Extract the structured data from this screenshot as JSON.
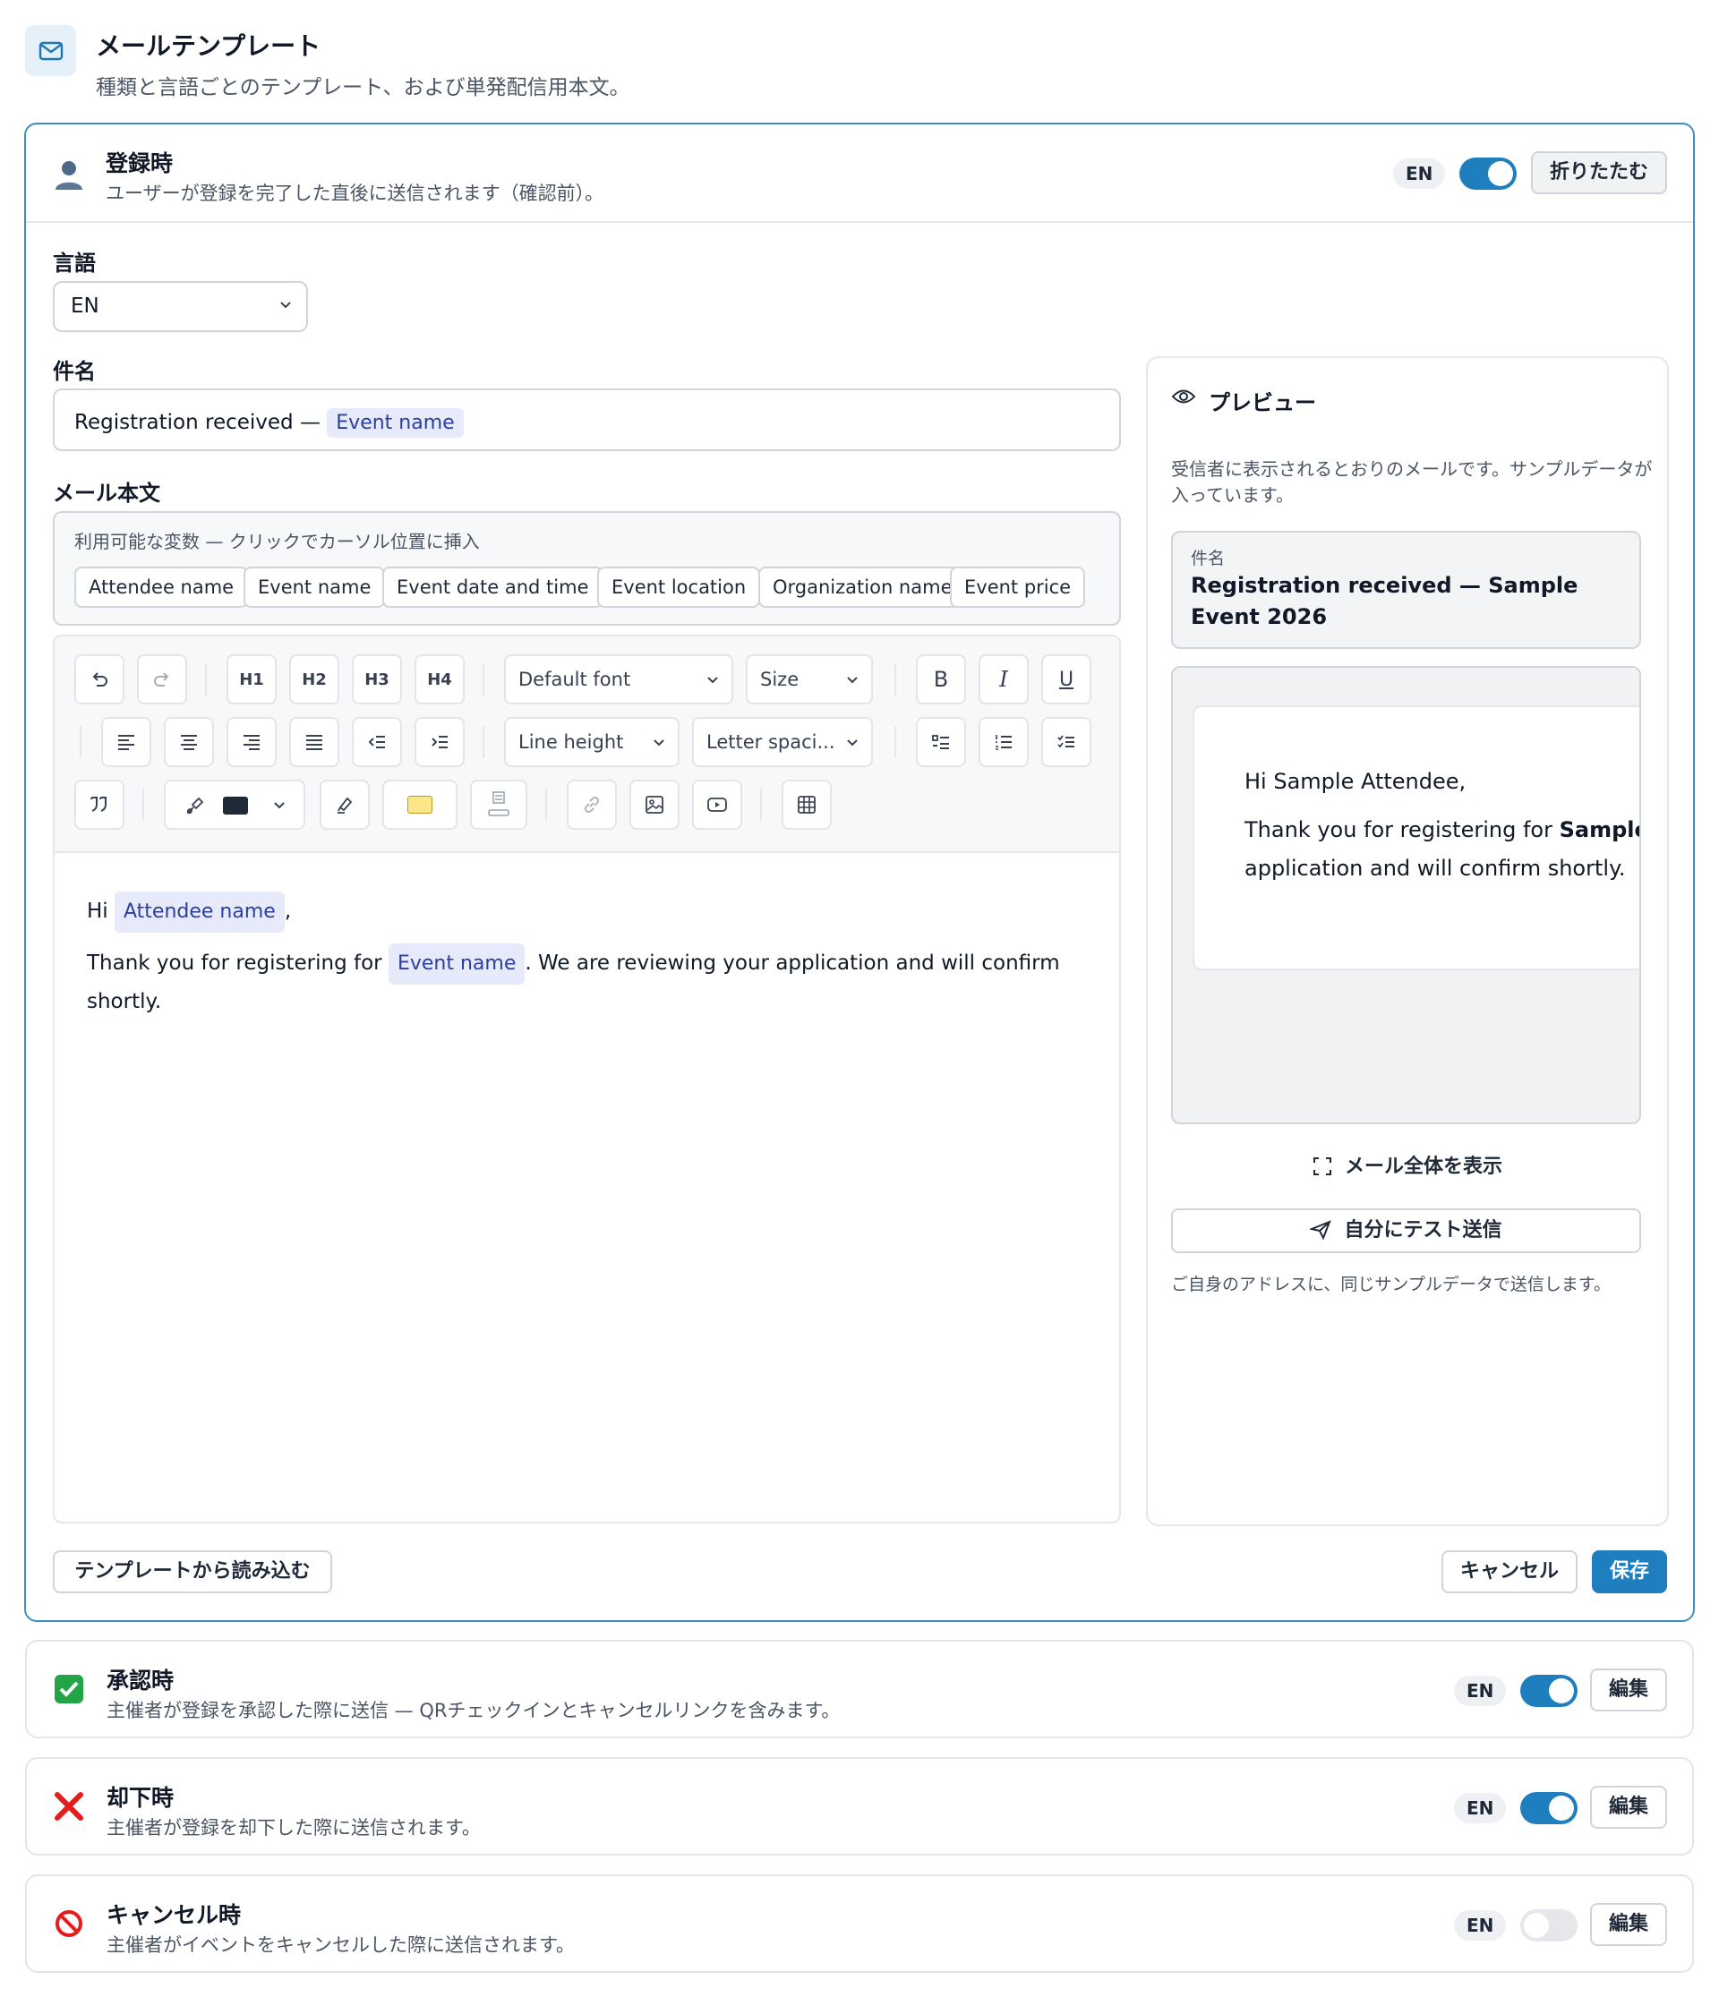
{
  "header": {
    "title": "メールテンプレート",
    "subtitle": "種類と言語ごとのテンプレート、および単発配信用本文。"
  },
  "registration": {
    "title": "登録時",
    "description": "ユーザーが登録を完了した直後に送信されます（確認前）。",
    "lang_badge": "EN",
    "enabled": true,
    "collapse_label": "折りたたむ",
    "language_label": "言語",
    "language_value": "EN",
    "subject_label": "件名",
    "subject_text": "Registration received —",
    "subject_token": "Event name",
    "body_label": "メール本文",
    "variables_hint": "利用可能な変数 — クリックでカーソル位置に挿入",
    "variables": [
      "Attendee name",
      "Event name",
      "Event date and time",
      "Event location",
      "Organization name",
      "Event price"
    ],
    "toolbar": {
      "headings": [
        "H1",
        "H2",
        "H3",
        "H4"
      ],
      "font": "Default font",
      "size": "Size",
      "line_height": "Line height",
      "letter_spacing": "Letter spaci...",
      "text_color": "#1f2937",
      "highlight_color": "#fde68a"
    },
    "body": {
      "greeting": "Hi",
      "greeting_token": "Attendee name",
      "greeting_end": ",",
      "line_start": "Thank you for registering for",
      "line_token": "Event name",
      "line_end": ". We are reviewing your application and will confirm shortly."
    },
    "load_template_label": "テンプレートから読み込む",
    "cancel_label": "キャンセル",
    "save_label": "保存"
  },
  "preview": {
    "title": "プレビュー",
    "description": "受信者に表示されるとおりのメールです。サンプルデータが入っています。",
    "subject_label": "件名",
    "subject_value": "Registration received — Sample Event 2026",
    "mail_greeting": "Hi Sample Attendee,",
    "mail_line1_start": "Thank you for registering for",
    "mail_line1_bold": "Sample",
    "mail_line2": "application and will confirm shortly.",
    "show_full_label": "メール全体を表示",
    "test_send_label": "自分にテスト送信",
    "test_send_note": "ご自身のアドレスに、同じサンプルデータで送信します。"
  },
  "templates": [
    {
      "title": "承認時",
      "description": "主催者が登録を承認した際に送信 — QRチェックインとキャンセルリンクを含みます。",
      "lang": "EN",
      "enabled": true,
      "edit_label": "編集",
      "icon": "check-icon",
      "icon_color": "#22a447"
    },
    {
      "title": "却下時",
      "description": "主催者が登録を却下した際に送信されます。",
      "lang": "EN",
      "enabled": true,
      "edit_label": "編集",
      "icon": "cross-icon",
      "icon_color": "#e11d1d"
    },
    {
      "title": "キャンセル時",
      "description": "主催者がイベントをキャンセルした際に送信されます。",
      "lang": "EN",
      "enabled": false,
      "edit_label": "編集",
      "icon": "prohibited-icon",
      "icon_color": "#e11d1d"
    }
  ]
}
